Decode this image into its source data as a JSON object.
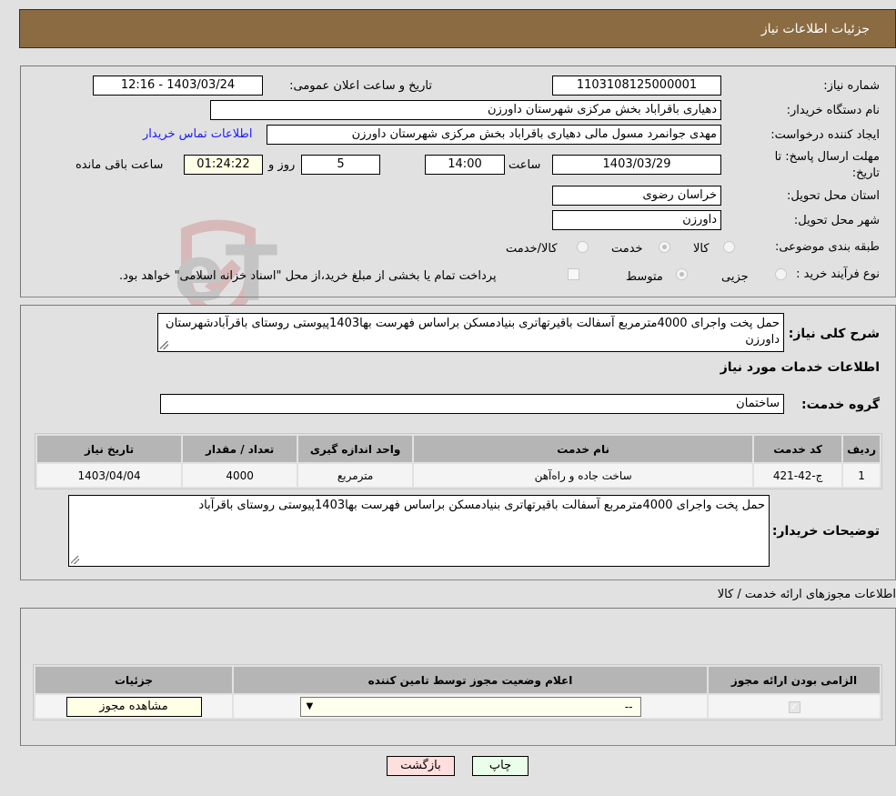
{
  "header": {
    "title": "جزئیات اطلاعات نیاز"
  },
  "form": {
    "need_number": {
      "label": "شماره نیاز:",
      "value": "1103108125000001"
    },
    "announce_datetime": {
      "label": "تاریخ و ساعت اعلان عمومی:",
      "value": "1403/03/24 - 12:16"
    },
    "buyer_org": {
      "label": "نام دستگاه خریدار:",
      "value": "دهیاری باقراباد بخش مرکزی شهرستان داورزن"
    },
    "requester": {
      "label": "ایجاد کننده درخواست:",
      "value": "مهدی جوانمرد مسول مالی دهیاری باقراباد بخش مرکزی شهرستان داورزن"
    },
    "buyer_contact_link": "اطلاعات تماس خریدار",
    "deadline": {
      "label_line1": "مهلت ارسال پاسخ: تا",
      "label_line2": "تاریخ:",
      "date": "1403/03/29",
      "time_label": "ساعت",
      "time": "14:00",
      "days": "5",
      "days_label": "روز و",
      "remaining": "01:24:22",
      "remaining_label": "ساعت باقی مانده"
    },
    "delivery_province": {
      "label": "استان محل تحویل:",
      "value": "خراسان رضوی"
    },
    "delivery_city": {
      "label": "شهر محل تحویل:",
      "value": "داورزن"
    },
    "category": {
      "label": "طبقه بندی موضوعی:",
      "options": [
        "کالا",
        "خدمت",
        "کالا/خدمت"
      ],
      "selected": "خدمت"
    },
    "purchase_process": {
      "label": "نوع فرآیند خرید :",
      "options": [
        "جزیی",
        "متوسط"
      ],
      "selected": "متوسط",
      "treasury_note": "پرداخت تمام یا بخشی از مبلغ خرید،از محل \"اسناد خزانه اسلامی\" خواهد بود."
    }
  },
  "summary": {
    "label": "شرح کلی نیاز:",
    "value": "حمل پخت واجرای 4000مترمربع آسفالت باقیرتهاتری بنیادمسکن براساس فهرست بها1403پیوستی روستای باقرآبادشهرستان داورزن"
  },
  "services": {
    "section_title": "اطلاعات خدمات مورد نیاز",
    "group_label": "گروه خدمت:",
    "group_value": "ساختمان",
    "columns": [
      "ردیف",
      "کد خدمت",
      "نام خدمت",
      "واحد اندازه گیری",
      "تعداد / مقدار",
      "تاریخ نیاز"
    ],
    "rows": [
      [
        "1",
        "ج-42-421",
        "ساخت جاده و راه‌آهن",
        "مترمربع",
        "4000",
        "1403/04/04"
      ]
    ]
  },
  "buyer_notes": {
    "label": "توضیحات خریدار:",
    "value": "حمل پخت واجرای 4000مترمربع آسفالت باقیرتهاتری بنیادمسکن براساس فهرست بها1403پیوستی روستای باقرآباد"
  },
  "permits": {
    "section_title": "اطلاعات مجوزهای ارائه خدمت / کالا",
    "columns": [
      "الزامی بودن ارائه مجوز",
      "اعلام وضعیت مجوز توسط تامین کننده",
      "جزئیات"
    ],
    "row": {
      "required_checked": true,
      "status_value": "--",
      "details_button": "مشاهده مجوز"
    }
  },
  "actions": {
    "print": "چاپ",
    "back": "بازگشت"
  },
  "watermark": "AriaTender.neT",
  "colors": {
    "header_bg": "#8b6b42",
    "link": "#1a1aff",
    "print_button_bg": "#eaffea",
    "back_button_bg": "#ffdede",
    "yellow_field": "#ffffe6"
  }
}
